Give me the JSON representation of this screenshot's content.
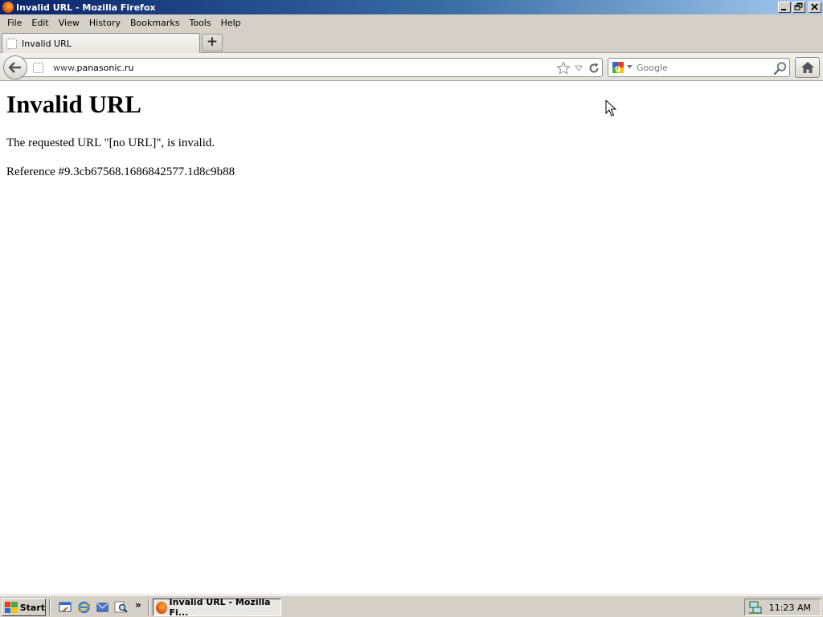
{
  "window": {
    "title": "Invalid URL - Mozilla Firefox",
    "buttons": [
      "minimize",
      "restore",
      "close"
    ]
  },
  "menubar": {
    "items": [
      {
        "label": "File"
      },
      {
        "label": "Edit"
      },
      {
        "label": "View"
      },
      {
        "label": "History"
      },
      {
        "label": "Bookmarks"
      },
      {
        "label": "Tools"
      },
      {
        "label": "Help"
      }
    ]
  },
  "tabs": {
    "items": [
      {
        "label": "Invalid URL",
        "active": true
      }
    ],
    "new_tab_label": "+"
  },
  "navbar": {
    "url_prefix": "www.",
    "url_domain": "panasonic.ru",
    "search_placeholder": "Google",
    "icons": [
      "back-arrow-icon",
      "identity-icon",
      "bookmark-star-icon",
      "url-history-dropdown-icon",
      "reload-icon",
      "google-icon",
      "search-engine-dropdown-icon",
      "magnifier-icon",
      "home-icon"
    ]
  },
  "page": {
    "heading": "Invalid URL",
    "message": "The requested URL \"[no URL]\", is invalid.",
    "reference": "Reference #9.3cb67568.1686842577.1d8c9b88"
  },
  "taskbar": {
    "start_label": "Start",
    "quicklaunch": [
      "show-desktop-icon",
      "internet-explorer-icon",
      "outlook-icon",
      "search-icon"
    ],
    "more_label": "»",
    "task_label": "Invalid URL - Mozilla Fi...",
    "clock": "11:23 AM"
  },
  "colors": {
    "titlebar_start": "#0a246a",
    "titlebar_end": "#a6caf0",
    "chrome": "#d4d0c8"
  }
}
